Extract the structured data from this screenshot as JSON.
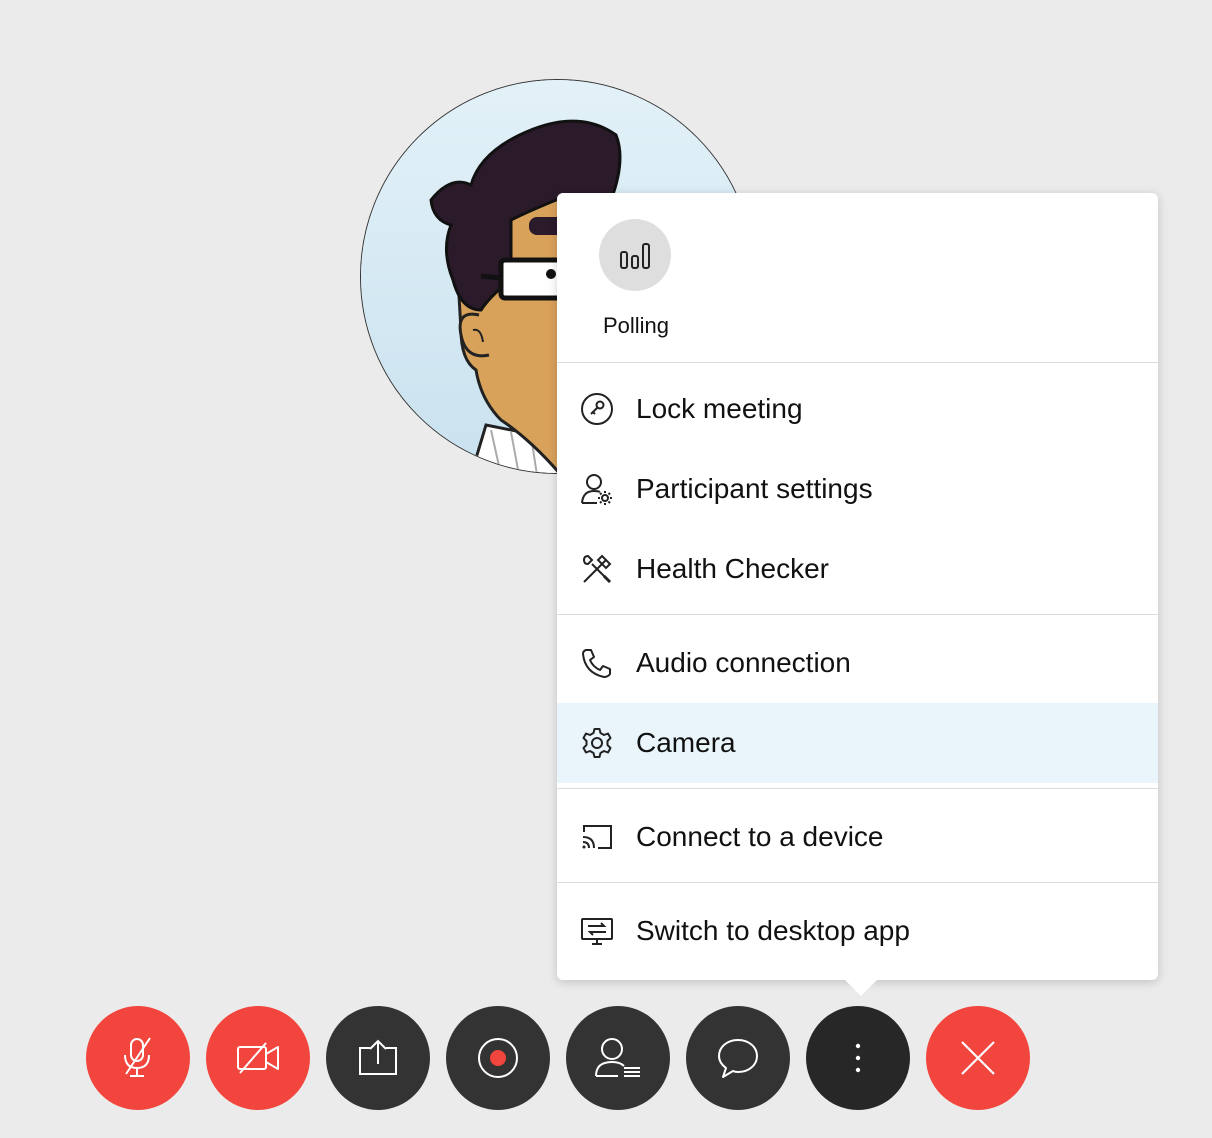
{
  "participant": {
    "avatar": "cartoon-avatar"
  },
  "more_menu": {
    "polling": {
      "label": "Polling",
      "icon": "bar-chart-icon"
    },
    "sections": [
      [
        {
          "label": "Lock meeting",
          "icon": "key-icon"
        },
        {
          "label": "Participant settings",
          "icon": "user-settings-icon"
        },
        {
          "label": "Health Checker",
          "icon": "tools-icon"
        }
      ],
      [
        {
          "label": "Audio connection",
          "icon": "phone-icon"
        },
        {
          "label": "Camera",
          "icon": "gear-icon",
          "highlighted": true
        }
      ],
      [
        {
          "label": "Connect to a device",
          "icon": "cast-icon"
        }
      ],
      [
        {
          "label": "Switch to desktop app",
          "icon": "desktop-switch-icon"
        }
      ]
    ]
  },
  "controls": [
    {
      "name": "mute-microphone",
      "icon": "mic-off-icon",
      "color": "#f1453d"
    },
    {
      "name": "stop-video",
      "icon": "video-off-icon",
      "color": "#f1453d"
    },
    {
      "name": "share-content",
      "icon": "share-icon",
      "color": "#333333"
    },
    {
      "name": "record",
      "icon": "record-icon",
      "color": "#333333"
    },
    {
      "name": "participants",
      "icon": "participants-icon",
      "color": "#333333"
    },
    {
      "name": "chat",
      "icon": "chat-icon",
      "color": "#333333"
    },
    {
      "name": "more-options",
      "icon": "more-vertical-icon",
      "color": "#272727"
    },
    {
      "name": "leave-meeting",
      "icon": "close-icon",
      "color": "#f1453d"
    }
  ],
  "colors": {
    "background": "#ebebeb",
    "menu_highlight": "#e9f5fb",
    "danger": "#f1453d",
    "control_dark": "#333333",
    "record_dot": "#f1453d"
  }
}
